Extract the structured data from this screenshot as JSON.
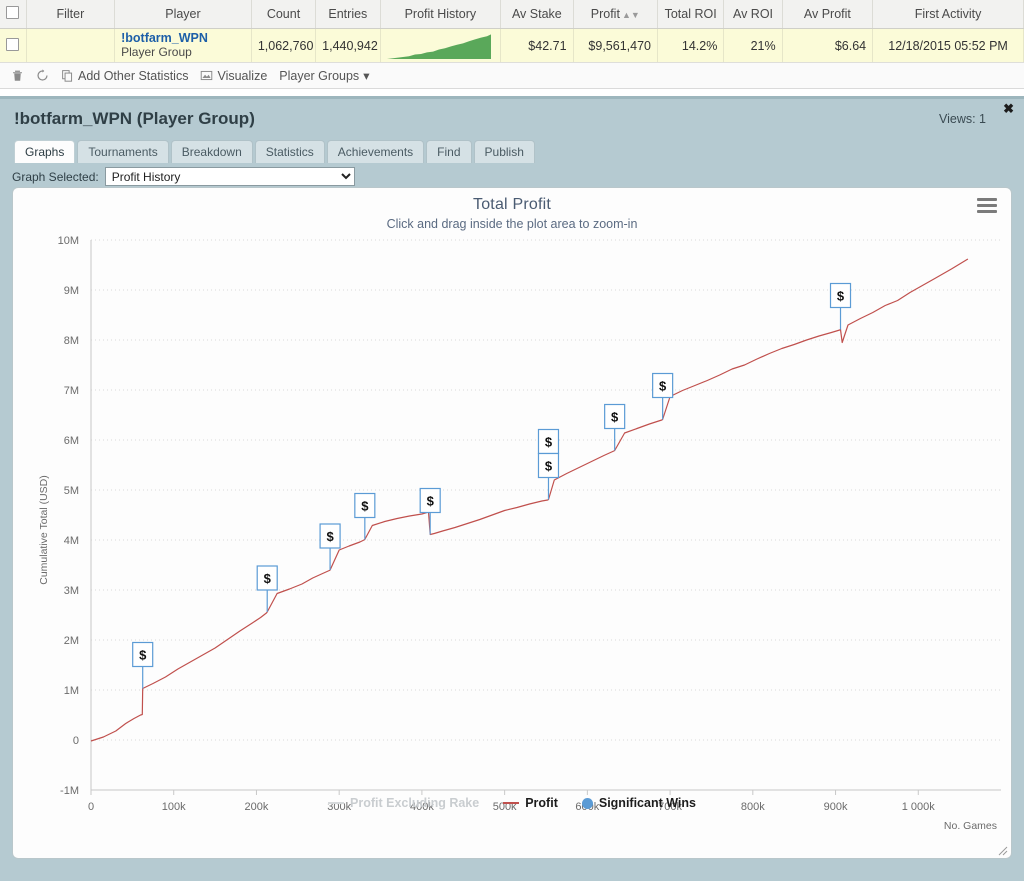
{
  "results_table": {
    "columns": [
      {
        "key": "checkbox",
        "label": ""
      },
      {
        "key": "filter",
        "label": "Filter"
      },
      {
        "key": "player",
        "label": "Player"
      },
      {
        "key": "count",
        "label": "Count"
      },
      {
        "key": "entries",
        "label": "Entries"
      },
      {
        "key": "profit_history",
        "label": "Profit History"
      },
      {
        "key": "av_stake",
        "label": "Av Stake"
      },
      {
        "key": "profit",
        "label": "Profit",
        "sort_icon": "sort-arrows-icon"
      },
      {
        "key": "total_roi",
        "label": "Total ROI"
      },
      {
        "key": "av_roi",
        "label": "Av ROI"
      },
      {
        "key": "av_profit",
        "label": "Av Profit"
      },
      {
        "key": "first_activity",
        "label": "First Activity"
      }
    ],
    "rows": [
      {
        "filter": "",
        "player_name": "!botfarm_WPN",
        "player_type": "Player Group",
        "count": "1,062,760",
        "entries": "1,440,942",
        "av_stake": "$42.71",
        "profit": "$9,561,470",
        "total_roi": "14.2%",
        "av_roi": "21%",
        "av_profit": "$6.64",
        "first_activity": "12/18/2015 05:52 PM",
        "sparkline_color": "#5aa85a"
      }
    ]
  },
  "action_toolbar": {
    "items": [
      {
        "icon": "trash-icon",
        "label": ""
      },
      {
        "icon": "refresh-icon",
        "label": ""
      },
      {
        "icon": "copy-icon",
        "label": "Add Other Statistics"
      },
      {
        "icon": "image-icon",
        "label": "Visualize"
      },
      {
        "icon": "",
        "label": "Player Groups",
        "caret": "▾"
      }
    ]
  },
  "detail_panel": {
    "title": "!botfarm_WPN (Player Group)",
    "views_label": "Views: 1",
    "close_label": "✖",
    "tabs": [
      {
        "label": "Graphs",
        "active": true
      },
      {
        "label": "Tournaments",
        "active": false
      },
      {
        "label": "Breakdown",
        "active": false
      },
      {
        "label": "Statistics",
        "active": false
      },
      {
        "label": "Achievements",
        "active": false
      },
      {
        "label": "Find",
        "active": false
      },
      {
        "label": "Publish",
        "active": false
      }
    ],
    "graph_select": {
      "label": "Graph Selected:",
      "value": "Profit History",
      "options": [
        "Profit History"
      ]
    },
    "panel_bg": "#b5cad1"
  },
  "chart_data": {
    "type": "line",
    "title": "Total Profit",
    "subtitle": "Click and drag inside the plot area to zoom-in",
    "xlabel": "No. Games",
    "ylabel": "Cumulative Total (USD)",
    "xlim": [
      0,
      1100000
    ],
    "ylim": [
      -1000000,
      10000000
    ],
    "grid": true,
    "legend_position": "bottom",
    "xticks": [
      "0",
      "100k",
      "200k",
      "300k",
      "400k",
      "500k",
      "600k",
      "700k",
      "800k",
      "900k",
      "1 000k"
    ],
    "xtick_values": [
      0,
      100000,
      200000,
      300000,
      400000,
      500000,
      600000,
      700000,
      800000,
      900000,
      1000000
    ],
    "yticks": [
      "-1M",
      "0",
      "1M",
      "2M",
      "3M",
      "4M",
      "5M",
      "6M",
      "7M",
      "8M",
      "9M",
      "10M"
    ],
    "ytick_values": [
      -1000000,
      0,
      1000000,
      2000000,
      3000000,
      4000000,
      5000000,
      6000000,
      7000000,
      8000000,
      9000000,
      10000000
    ],
    "series": [
      {
        "name": "Profit Excluding Rake",
        "color": "#d6d9db",
        "enabled": false,
        "values": []
      },
      {
        "name": "Profit",
        "color": "#c0504d",
        "enabled": true,
        "x": [
          0,
          15000,
          30000,
          42000,
          52000,
          60000,
          62000,
          62500,
          75000,
          90000,
          105000,
          120000,
          135000,
          150000,
          165000,
          180000,
          195000,
          205000,
          212000,
          213000,
          225000,
          240000,
          255000,
          268000,
          280000,
          288000,
          289000,
          300000,
          312000,
          325000,
          330000,
          331000,
          340000,
          355000,
          370000,
          385000,
          400000,
          408000,
          410000,
          415000,
          425000,
          440000,
          455000,
          470000,
          485000,
          500000,
          515000,
          530000,
          545000,
          552000,
          553000,
          560000,
          575000,
          590000,
          605000,
          620000,
          632000,
          633000,
          645000,
          660000,
          675000,
          688000,
          690000,
          691000,
          700000,
          715000,
          730000,
          745000,
          760000,
          775000,
          790000,
          805000,
          820000,
          835000,
          850000,
          865000,
          880000,
          895000,
          905000,
          906000,
          908000,
          915000,
          930000,
          945000,
          960000,
          975000,
          990000,
          1005000,
          1020000,
          1040000,
          1060000
        ],
        "y": [
          -20000,
          60000,
          180000,
          330000,
          430000,
          500000,
          510000,
          1030000,
          1130000,
          1260000,
          1420000,
          1560000,
          1700000,
          1840000,
          2010000,
          2180000,
          2340000,
          2450000,
          2540000,
          2560000,
          2930000,
          3020000,
          3120000,
          3240000,
          3330000,
          3390000,
          3400000,
          3800000,
          3880000,
          3960000,
          4000000,
          4010000,
          4290000,
          4370000,
          4430000,
          4480000,
          4520000,
          4560000,
          4110000,
          4130000,
          4180000,
          4250000,
          4330000,
          4410000,
          4500000,
          4590000,
          4650000,
          4720000,
          4780000,
          4800000,
          4810000,
          5200000,
          5330000,
          5450000,
          5570000,
          5690000,
          5780000,
          5790000,
          6140000,
          6230000,
          6320000,
          6390000,
          6400000,
          6410000,
          6870000,
          6990000,
          7090000,
          7190000,
          7300000,
          7420000,
          7500000,
          7620000,
          7730000,
          7830000,
          7910000,
          8000000,
          8080000,
          8150000,
          8200000,
          8210000,
          7950000,
          8300000,
          8430000,
          8550000,
          8690000,
          8790000,
          8950000,
          9090000,
          9230000,
          9420000,
          9620000
        ]
      }
    ],
    "markers": {
      "name": "Significant Wins",
      "color": "#5b9bd5",
      "glyph": "$",
      "points": [
        {
          "x": 62500,
          "y": 1030000,
          "stack": 1
        },
        {
          "x": 213000,
          "y": 2560000,
          "stack": 1
        },
        {
          "x": 289000,
          "y": 3400000,
          "stack": 1
        },
        {
          "x": 331000,
          "y": 4010000,
          "stack": 1
        },
        {
          "x": 410000,
          "y": 4110000,
          "stack": 1
        },
        {
          "x": 553000,
          "y": 4810000,
          "stack": 2
        },
        {
          "x": 633000,
          "y": 5790000,
          "stack": 1
        },
        {
          "x": 691000,
          "y": 6410000,
          "stack": 1
        },
        {
          "x": 906000,
          "y": 8210000,
          "stack": 1
        }
      ]
    }
  }
}
